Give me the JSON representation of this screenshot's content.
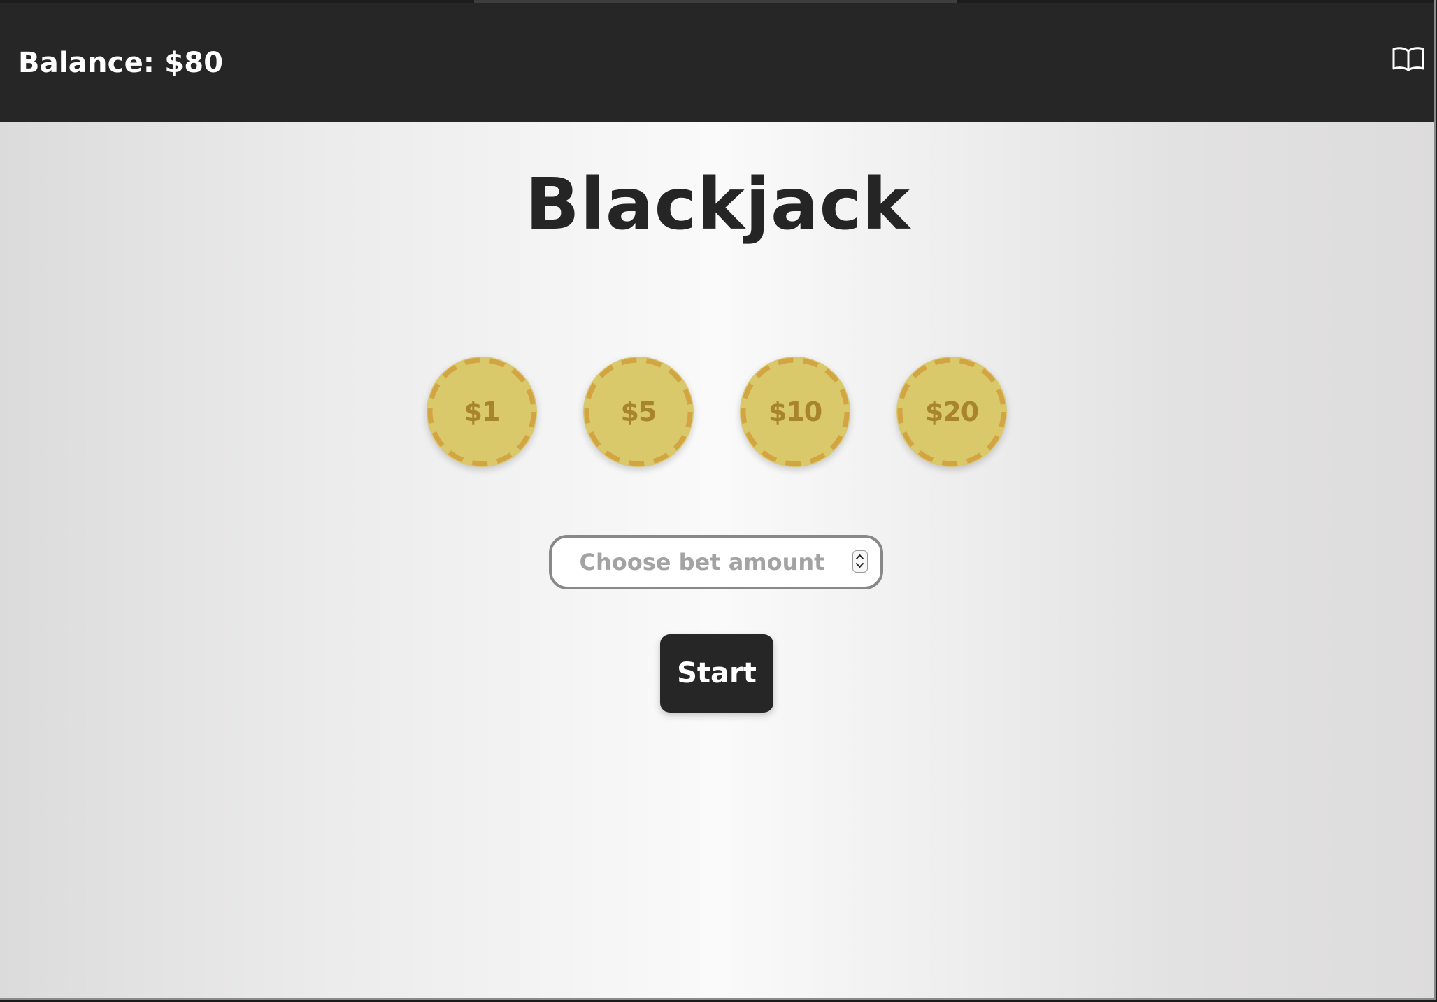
{
  "header": {
    "balance": "Balance: $80",
    "guide_icon": "book-open-icon"
  },
  "title": "Blackjack",
  "chips": [
    {
      "label": "$1",
      "value": 1
    },
    {
      "label": "$5",
      "value": 5
    },
    {
      "label": "$10",
      "value": 10
    },
    {
      "label": "$20",
      "value": 20
    }
  ],
  "bet": {
    "placeholder": "Choose bet amount",
    "value": "",
    "stepper_icon": "up-down-stepper-icon"
  },
  "start_label": "Start",
  "colors": {
    "topbar": "#262626",
    "chip_fill": "#d9c96b",
    "chip_dash": "#d3a442",
    "chip_text": "#a8852a",
    "button": "#262626",
    "title": "#252525"
  }
}
